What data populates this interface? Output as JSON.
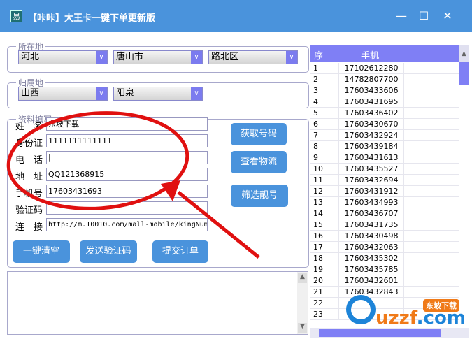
{
  "window": {
    "title": "【咔咔】大王卡一键下单更新版",
    "icon": "app-icon",
    "minimize": "—",
    "maximize": "☐",
    "close": "✕"
  },
  "location": {
    "label": "所在地",
    "province": "河北",
    "city": "唐山市",
    "district": "路北区"
  },
  "home": {
    "label": "归属地",
    "province": "山西",
    "city": "阳泉"
  },
  "form": {
    "label": "资料填写",
    "fields": [
      {
        "label": "姓　名",
        "value": "东坡下载"
      },
      {
        "label": "身份证",
        "value": "1111111111111"
      },
      {
        "label": "电　话",
        "value": "|"
      },
      {
        "label": "地　址",
        "value": "QQ121368915"
      },
      {
        "label": "手机号",
        "value": "17603431693"
      },
      {
        "label": "验证码",
        "value": ""
      },
      {
        "label": "连　接",
        "value": "http://m.10010.com/mall-mobile/kingNum"
      }
    ],
    "get_number": "获取号码",
    "view_logistics": "查看物流",
    "filter_number": "筛选靓号",
    "clear_all": "一键清空",
    "send_code": "发送验证码",
    "submit_order": "提交订单"
  },
  "table": {
    "headers": [
      "序",
      "手机"
    ],
    "rows": [
      [
        "1",
        "17102612280"
      ],
      [
        "2",
        "14782807700"
      ],
      [
        "3",
        "17603433606"
      ],
      [
        "4",
        "17603431695"
      ],
      [
        "5",
        "17603436402"
      ],
      [
        "6",
        "17603430670"
      ],
      [
        "7",
        "17603432924"
      ],
      [
        "8",
        "17603439184"
      ],
      [
        "9",
        "17603431613"
      ],
      [
        "10",
        "17603435527"
      ],
      [
        "11",
        "17603432694"
      ],
      [
        "12",
        "17603431912"
      ],
      [
        "13",
        "17603434993"
      ],
      [
        "14",
        "17603436707"
      ],
      [
        "15",
        "17603431735"
      ],
      [
        "16",
        "17603430498"
      ],
      [
        "17",
        "17603432063"
      ],
      [
        "18",
        "17603435302"
      ],
      [
        "19",
        "17603435785"
      ],
      [
        "20",
        "17603432601"
      ],
      [
        "21",
        "17603432843"
      ],
      [
        "22",
        ""
      ],
      [
        "23",
        ""
      ]
    ]
  },
  "watermark": {
    "text": "uzzf.com",
    "badge": "东坡下载"
  },
  "colors": {
    "titlebar": "#4a93dc",
    "header": "#7f7ff5",
    "annotation": "#e01010"
  }
}
